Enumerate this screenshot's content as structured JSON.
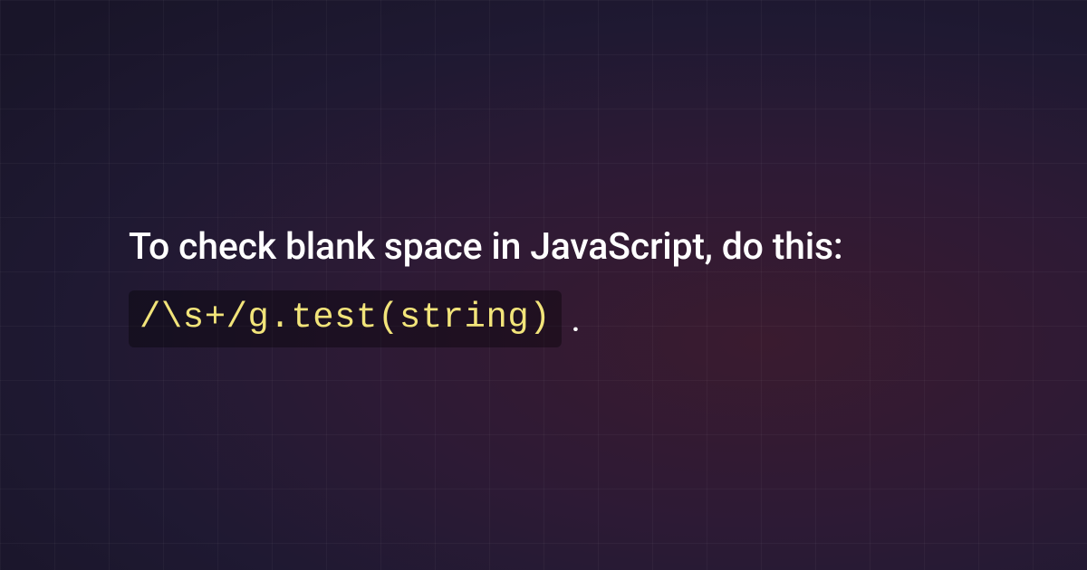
{
  "heading": "To check blank space in JavaScript, do this:",
  "code": "/\\s+/g.test(string)",
  "period": "."
}
